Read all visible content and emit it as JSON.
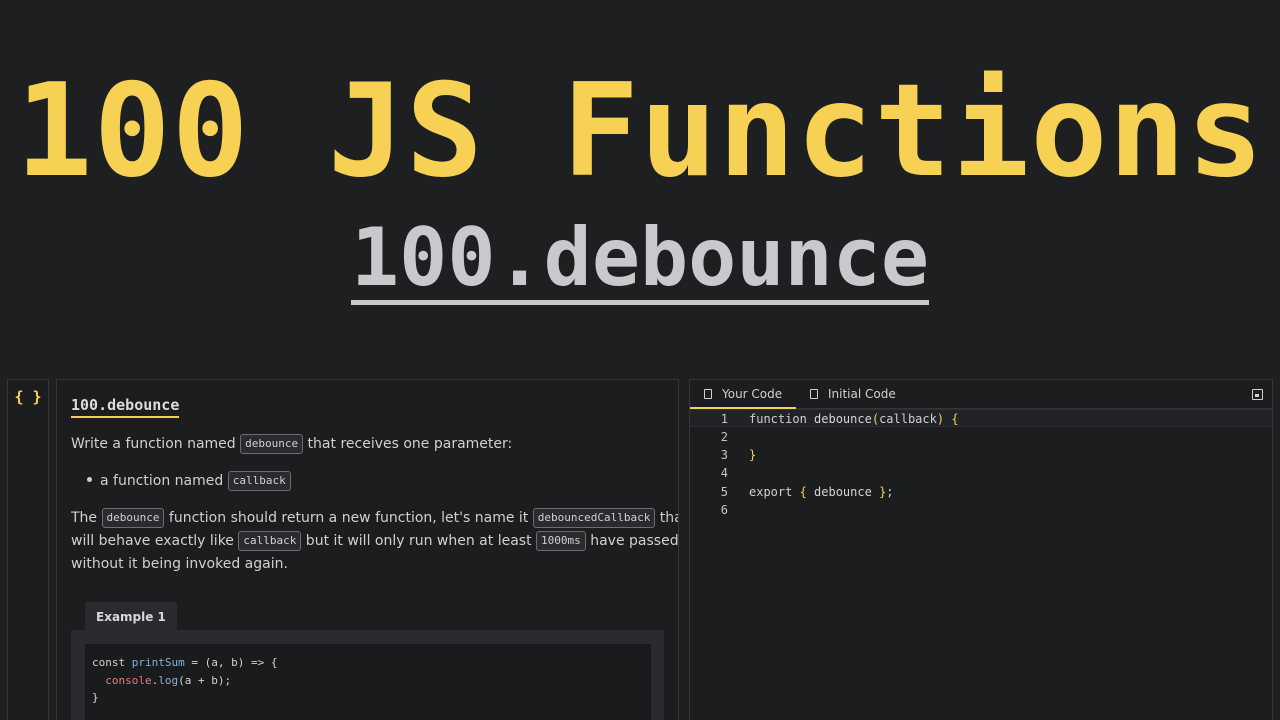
{
  "hero": {
    "title": "100 JS Functions",
    "subtitle": "100.debounce"
  },
  "rail": {
    "icon": "{ }",
    "icon_name": "braces-icon"
  },
  "description": {
    "title": "100.debounce",
    "p1_pre": "Write a function named ",
    "p1_code": "debounce",
    "p1_post": " that receives one parameter:",
    "bullet_pre": "a function named ",
    "bullet_code": "callback",
    "p2_a": "The ",
    "p2_code1": "debounce",
    "p2_b": " function should return a new function, let's name it ",
    "p2_code2": "debouncedCallback",
    "p2_c": " that",
    "p3_a": "will behave exactly like ",
    "p3_code1": "callback",
    "p3_b": " but it will only run when at least ",
    "p3_code2": "1000ms",
    "p3_c": " have passed",
    "p4": "without it being invoked again.",
    "example_tab": "Example 1",
    "example_code": {
      "l1_kw": "const ",
      "l1_fn": "printSum",
      "l1_rest": " = (a, b) => {",
      "l2_obj": "  console",
      "l2_dot": ".",
      "l2_fn": "log",
      "l2_rest": "(a + b);",
      "l3": "}"
    }
  },
  "editor": {
    "tabs": [
      {
        "label": "Your Code",
        "active": true
      },
      {
        "label": "Initial Code",
        "active": false
      }
    ],
    "save_icon": "save-icon",
    "lines": [
      {
        "n": "1",
        "kw": "function ",
        "name": "debounce",
        "p1": "(",
        "arg": "callback",
        "p2": ")",
        "sp": " ",
        "br": "{"
      },
      {
        "n": "2"
      },
      {
        "n": "3",
        "br": "}"
      },
      {
        "n": "4"
      },
      {
        "n": "5",
        "kw": "export ",
        "br1": "{",
        "mid": " debounce ",
        "br2": "}",
        "end": ";"
      },
      {
        "n": "6"
      }
    ]
  },
  "colors": {
    "accent": "#f7d154",
    "background": "#1e1f21",
    "panel": "#1c1d1f"
  }
}
